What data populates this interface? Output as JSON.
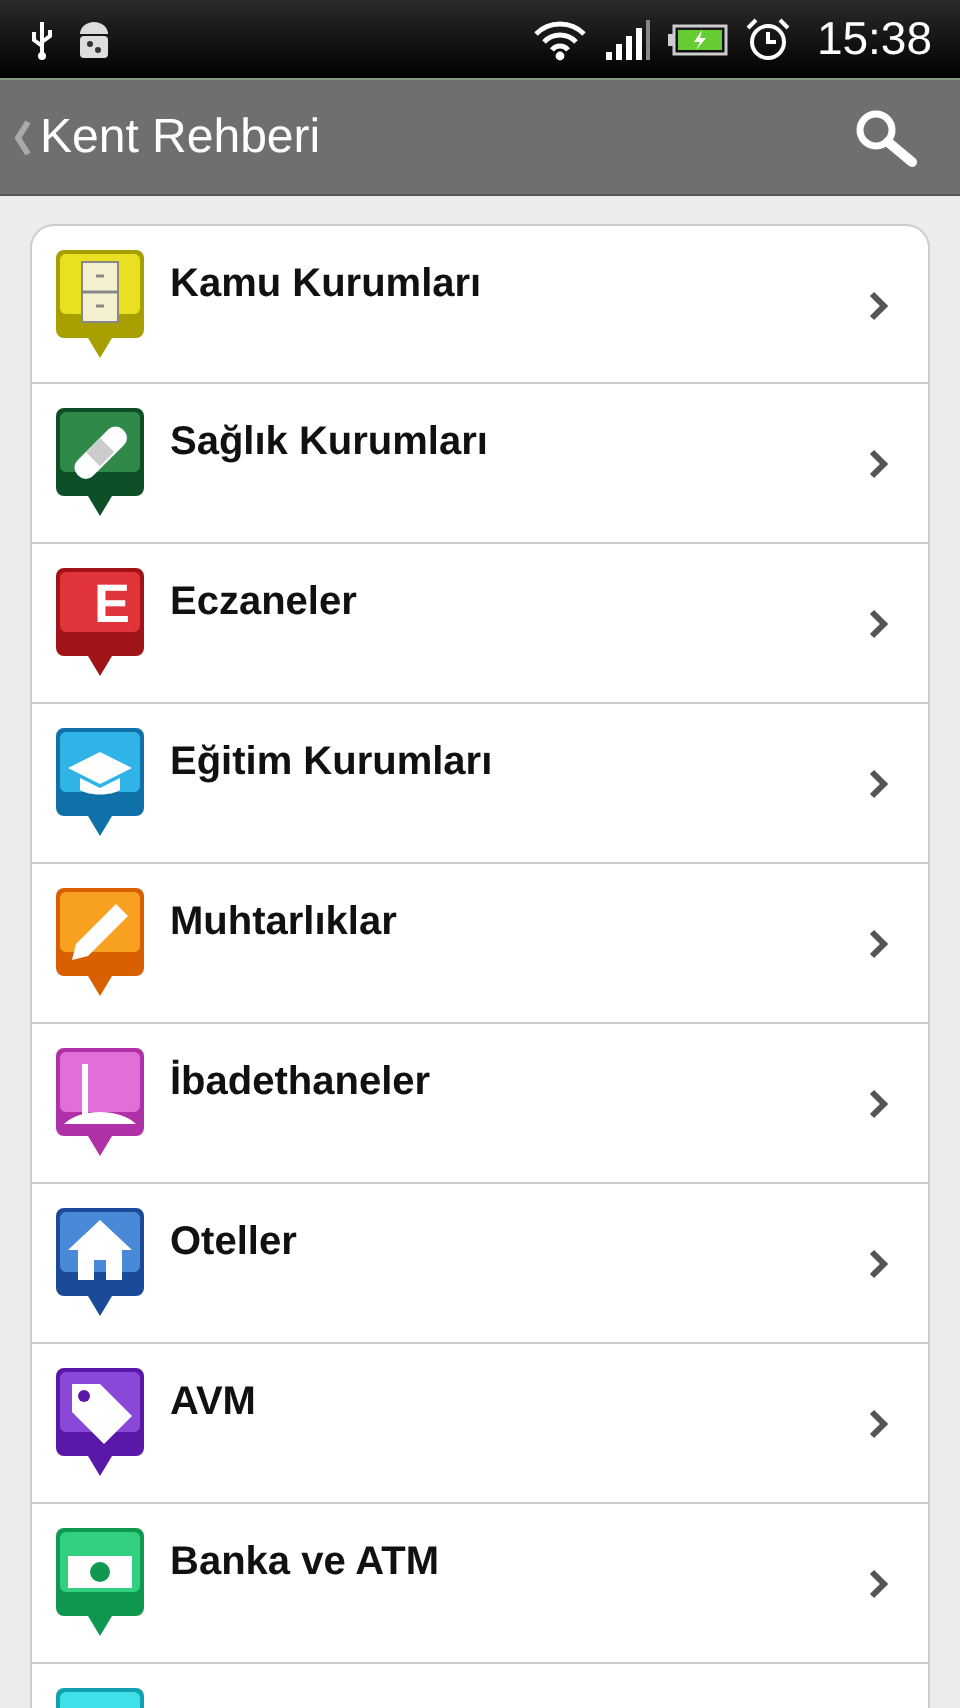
{
  "status_bar": {
    "time": "15:38"
  },
  "app_bar": {
    "title": "Kent Rehberi"
  },
  "items": [
    {
      "kind": "cabinet",
      "label": "Kamu Kurumları"
    },
    {
      "kind": "bandage",
      "label": "Sağlık Kurumları"
    },
    {
      "kind": "letter",
      "glyph": "E",
      "label": "Eczaneler"
    },
    {
      "kind": "cap",
      "label": "Eğitim Kurumları"
    },
    {
      "kind": "pencil",
      "label": "Muhtarlıklar"
    },
    {
      "kind": "mosque",
      "label": "İbadethaneler"
    },
    {
      "kind": "house",
      "label": "Oteller"
    },
    {
      "kind": "tag",
      "label": "AVM"
    },
    {
      "kind": "money",
      "label": "Banka ve ATM"
    },
    {
      "kind": "partial"
    }
  ]
}
